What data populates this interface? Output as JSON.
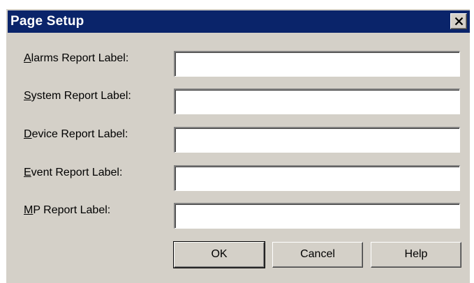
{
  "dialog": {
    "title": "Page Setup",
    "close_symbol": "×"
  },
  "fields": [
    {
      "label_accel": "A",
      "label_rest": "larms Report Label:",
      "value": ""
    },
    {
      "label_accel": "S",
      "label_rest": "ystem Report Label:",
      "value": ""
    },
    {
      "label_accel": "D",
      "label_rest": "evice Report Label:",
      "value": ""
    },
    {
      "label_accel": "E",
      "label_rest": "vent Report Label:",
      "value": ""
    },
    {
      "label_accel": "M",
      "label_rest": "P Report Label:",
      "value": ""
    }
  ],
  "buttons": {
    "ok": "OK",
    "cancel": "Cancel",
    "help": "Help"
  },
  "icons": {
    "close": "close-icon"
  },
  "colors": {
    "titlebar": "#0a246a",
    "dialog_face": "#d4d0c8",
    "field_bg": "#ffffff"
  }
}
